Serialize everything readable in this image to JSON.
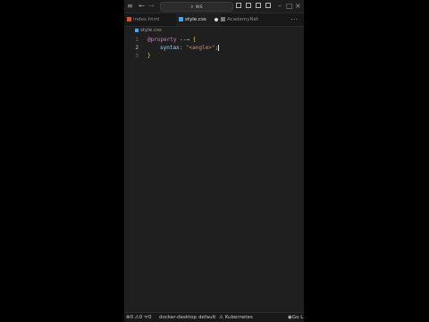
{
  "titlebar": {
    "search_text": "ws",
    "back_icon": "arrow-left-icon",
    "forward_icon": "arrow-right-icon"
  },
  "tabs": [
    {
      "label": "index.html",
      "active": false
    },
    {
      "label": "style.css",
      "active": true,
      "modified": true
    },
    {
      "label": "AcademyNet",
      "active": false
    }
  ],
  "breadcrumb": {
    "label": "style.css"
  },
  "editor": {
    "lines": [
      {
        "number": "1",
        "at": "@",
        "keyword": "property",
        "arrow": " --→ ",
        "brace": "{"
      },
      {
        "number": "2",
        "prop": "syntax",
        "colon": ": ",
        "string": "\"<angle>\"",
        "semicolon": ";"
      },
      {
        "number": "3",
        "brace": "}"
      }
    ]
  },
  "status": {
    "errors": "0",
    "warnings": "0",
    "ports": "0",
    "docker": "docker-desktop",
    "namespace": "default",
    "kubernetes": "Kubernetes",
    "golive": "Go L"
  }
}
